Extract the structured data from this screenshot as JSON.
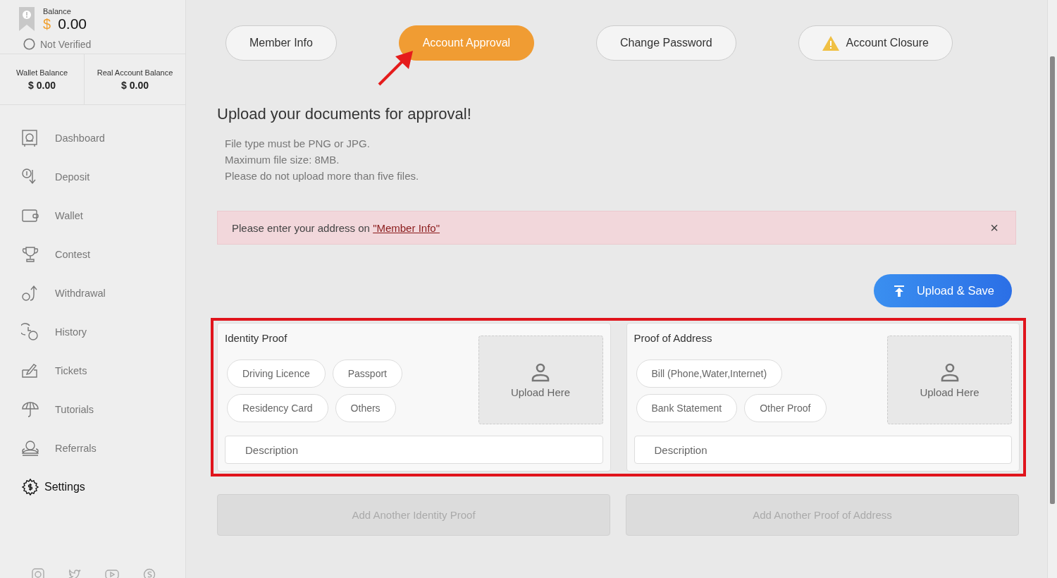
{
  "balance": {
    "label": "Balance",
    "currency": "$",
    "amount": "0.00",
    "status": "Not Verified"
  },
  "sub_balances": [
    {
      "label": "Wallet Balance",
      "value": "$ 0.00"
    },
    {
      "label": "Real Account Balance",
      "value": "$ 0.00"
    }
  ],
  "sidebar": {
    "items": [
      {
        "label": "Dashboard",
        "selected": false
      },
      {
        "label": "Deposit",
        "selected": false
      },
      {
        "label": "Wallet",
        "selected": false
      },
      {
        "label": "Contest",
        "selected": false
      },
      {
        "label": "Withdrawal",
        "selected": false
      },
      {
        "label": "History",
        "selected": false
      },
      {
        "label": "Tickets",
        "selected": false
      },
      {
        "label": "Tutorials",
        "selected": false
      },
      {
        "label": "Referrals",
        "selected": false
      },
      {
        "label": "Settings",
        "selected": true
      }
    ]
  },
  "tabs": [
    {
      "label": "Member Info",
      "selected": false,
      "kind": "plain"
    },
    {
      "label": "Account Approval",
      "selected": true,
      "kind": "plain"
    },
    {
      "label": "Change Password",
      "selected": false,
      "kind": "plain"
    },
    {
      "label": "Account Closure",
      "selected": false,
      "kind": "warning"
    }
  ],
  "heading": "Upload your documents for approval!",
  "rules": [
    "File type must be PNG or JPG.",
    "Maximum file size: 8MB.",
    "Please do not upload more than five files."
  ],
  "alert": {
    "text": "Please enter your address on ",
    "link": "\"Member Info\"",
    "close": "×"
  },
  "upload_button": "Upload & Save",
  "cards": [
    {
      "title": "Identity Proof",
      "options": [
        "Driving Licence",
        "Passport",
        "Residency Card",
        "Others"
      ],
      "upload": "Upload Here",
      "description_placeholder": "Description",
      "add_button": "Add Another Identity Proof"
    },
    {
      "title": "Proof of Address",
      "options": [
        "Bill (Phone,Water,Internet)",
        "Bank Statement",
        "Other Proof"
      ],
      "upload": "Upload Here",
      "description_placeholder": "Description",
      "add_button": "Add Another Proof of Address"
    }
  ]
}
